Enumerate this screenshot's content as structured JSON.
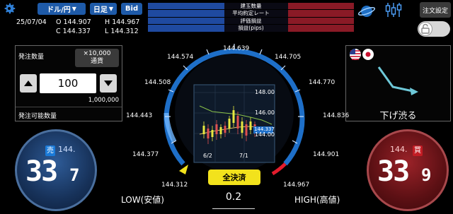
{
  "header": {
    "pair": "ドル/円",
    "timeframe": "日足",
    "side": "Bid",
    "date": "25/07/04",
    "open_label": "O",
    "open": "144.907",
    "high_label": "H",
    "high": "144.967",
    "close_label": "C",
    "close": "144.337",
    "low_label": "L",
    "low": "144.312",
    "rows": [
      "建玉数量",
      "平均約定レート",
      "評価損益",
      "損益(pips)"
    ],
    "order_settings": "注文設定"
  },
  "order": {
    "qty_label": "発注数量",
    "unit_line1": "×10,000",
    "unit_line2": "通貨",
    "quantity": "100",
    "max_qty": "1,000,000",
    "available_label": "発注可能数量"
  },
  "trend": {
    "text": "下げ渋る",
    "flags": [
      "us-flag-icon",
      "jp-flag-icon"
    ]
  },
  "gauge": {
    "left_labels": [
      "144.574",
      "144.508",
      "144.443",
      "144.377",
      "144.312"
    ],
    "top_label": "144.639",
    "right_labels": [
      "144.705",
      "144.770",
      "144.836",
      "144.901",
      "144.967"
    ],
    "chart_prices": [
      "148.00",
      "146.00",
      "144.00"
    ],
    "current_price": "144.337",
    "chart_dates": [
      "6/2",
      "7/1"
    ]
  },
  "sell": {
    "label": "売",
    "prefix": "144.",
    "main": "33",
    "pip": "7"
  },
  "buy": {
    "label": "買",
    "prefix": "144.",
    "main": "33",
    "pip": "9"
  },
  "settle_all": "全決済",
  "spread": "0.2",
  "low_text": "LOW(安値)",
  "high_text": "HIGH(高値)",
  "colors": {
    "accent_blue": "#1e5aa8",
    "sell": "#17325a",
    "buy": "#5c1014",
    "settle": "#f2e21c"
  }
}
